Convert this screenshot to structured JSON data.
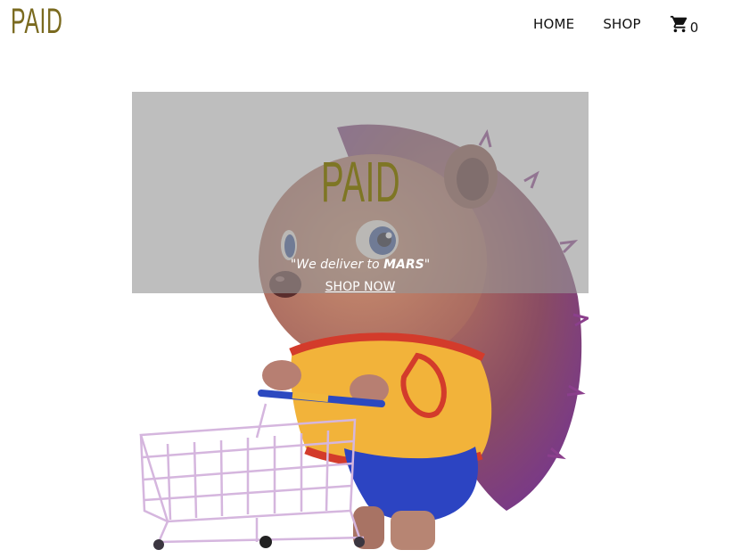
{
  "header": {
    "logo": "PAID",
    "nav": {
      "home": "HOME",
      "shop": "SHOP"
    },
    "cart": {
      "icon": "shopping-cart-icon",
      "count": "0"
    }
  },
  "hero": {
    "logo": "PAID",
    "tagline_prefix": "\"We deliver to ",
    "tagline_brand": "MARS",
    "tagline_suffix": "\"",
    "cta": "SHOP NOW",
    "image": "hedgehog-with-shopping-cart"
  },
  "colors": {
    "logo": "#7a6a1f",
    "overlay": "#969696",
    "text": "#111111"
  }
}
